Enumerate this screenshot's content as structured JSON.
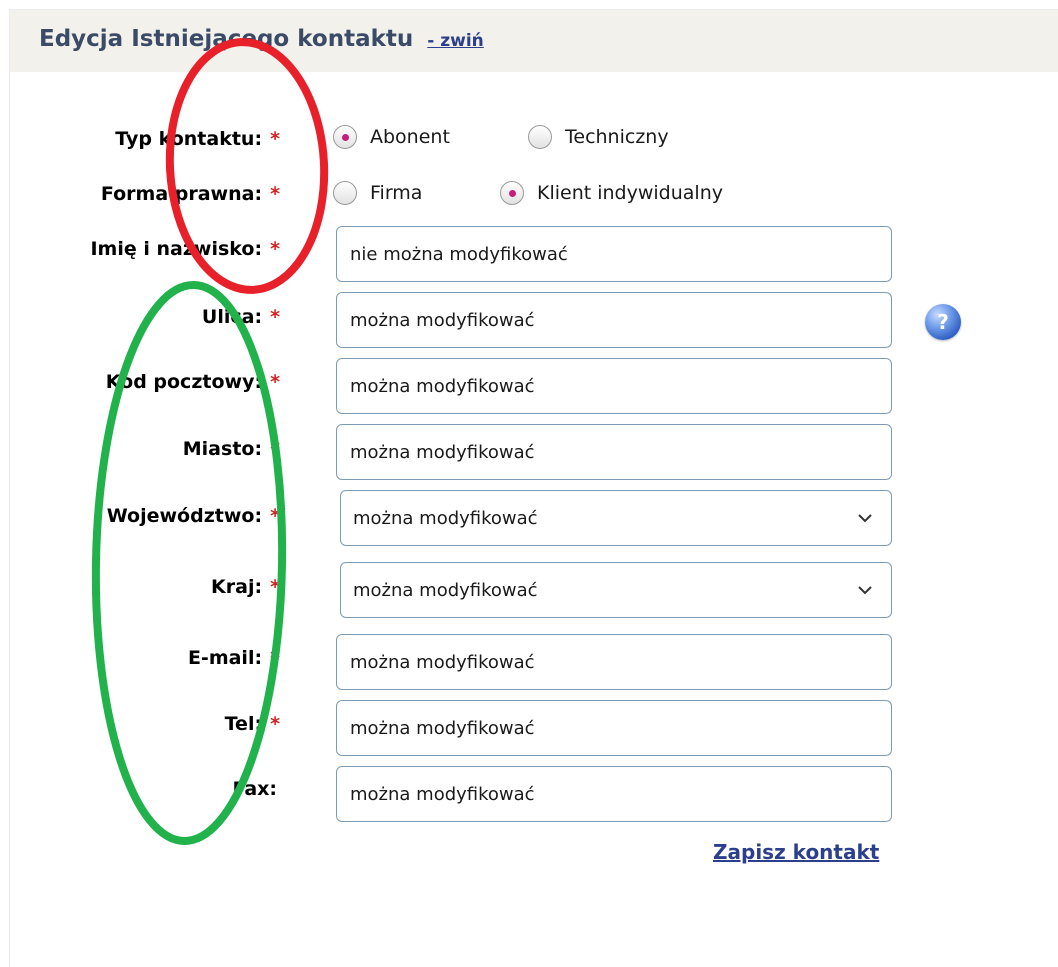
{
  "header": {
    "title": "Edycja Istniejącego kontaktu",
    "collapse_link": "- zwiń"
  },
  "form": {
    "required_marker": "*",
    "contact_type": {
      "label": "Typ kontaktu:",
      "options": [
        {
          "label": "Abonent",
          "selected": true
        },
        {
          "label": "Techniczny",
          "selected": false
        }
      ]
    },
    "legal_form": {
      "label": "Forma prawna:",
      "options": [
        {
          "label": "Firma",
          "selected": false
        },
        {
          "label": "Klient indywidualny",
          "selected": true
        }
      ]
    },
    "name": {
      "label": "Imię i nazwisko:",
      "value": "nie można modyfikować"
    },
    "street": {
      "label": "Ulica:",
      "value": "można modyfikować"
    },
    "postal_code": {
      "label": "Kod pocztowy:",
      "value": "można modyfikować"
    },
    "city": {
      "label": "Miasto:",
      "value": "można modyfikować"
    },
    "voivodeship": {
      "label": "Województwo:",
      "value": "można modyfikować"
    },
    "country": {
      "label": "Kraj:",
      "value": "można modyfikować"
    },
    "email": {
      "label": "E-mail:",
      "value": "można modyfikować"
    },
    "phone": {
      "label": "Tel:",
      "value": "można modyfikować"
    },
    "fax": {
      "label": "Fax:",
      "value": "można modyfikować"
    },
    "help_icon_glyph": "?",
    "save_link": "Zapisz kontakt"
  },
  "colors": {
    "header_bg": "#f3f1ec",
    "title": "#3b4a66",
    "link": "#2c3f8c",
    "required": "#d42222",
    "radio_dot": "#c51d7a",
    "input_border": "#7e9bb5",
    "annotation_red": "#e8202a",
    "annotation_green": "#22b24c"
  }
}
